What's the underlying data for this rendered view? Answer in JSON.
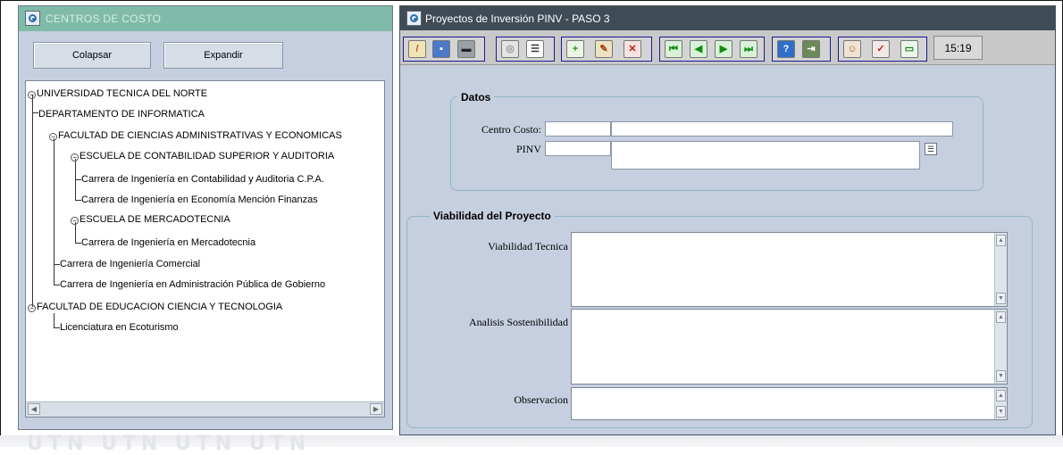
{
  "left_window": {
    "title": "CENTROS DE COSTO",
    "collapse_label": "Colapsar",
    "expand_label": "Expandir",
    "tree": [
      "UNIVERSIDAD TECNICA DEL NORTE",
      "DEPARTAMENTO DE INFORMATICA",
      "FACULTAD DE CIENCIAS ADMINISTRATIVAS Y ECONOMICAS",
      "ESCUELA DE CONTABILIDAD SUPERIOR Y AUDITORIA",
      "Carrera de Ingeniería en Contabilidad y Auditoria C.P.A.",
      "Carrera de Ingeniería en Economía Mención Finanzas",
      "ESCUELA DE MERCADOTECNIA",
      "Carrera de Ingeniería en Mercadotecnia",
      "Carrera de Ingeniería Comercial",
      "Carrera de Ingeniería en Administración Pública de Gobierno",
      "FACULTAD DE EDUCACION CIENCIA Y TECNOLOGIA",
      "Licenciatura en Ecoturismo"
    ]
  },
  "right_window": {
    "title": "Proyectos de Inversión PINV - PASO 3",
    "clock": "15:19",
    "datos": {
      "legend": "Datos",
      "centro_costo_label": "Centro Costo:",
      "pinv_label": "PINV"
    },
    "viabilidad": {
      "legend": "Viabilidad del Proyecto",
      "tecnica_label": "Viabilidad Tecnica",
      "sostenibilidad_label": "Analisis Sostenibilidad",
      "observacion_label": "Observacion"
    }
  },
  "toolbar_icons": [
    "broom-icon",
    "save-icon",
    "print-icon",
    "preview-icon",
    "list-icon",
    "insert-record-icon",
    "edit-record-icon",
    "delete-record-icon",
    "first-record-icon",
    "previous-record-icon",
    "next-record-icon",
    "last-record-icon",
    "help-icon",
    "exit-icon",
    "user-icon",
    "check-icon",
    "window-icon"
  ],
  "colors": {
    "left_titlebar": "#7fbba8",
    "right_titlebar": "#3f4b55",
    "panel_bg": "#c6cfdf",
    "toolbar_border": "#1a1a90"
  }
}
